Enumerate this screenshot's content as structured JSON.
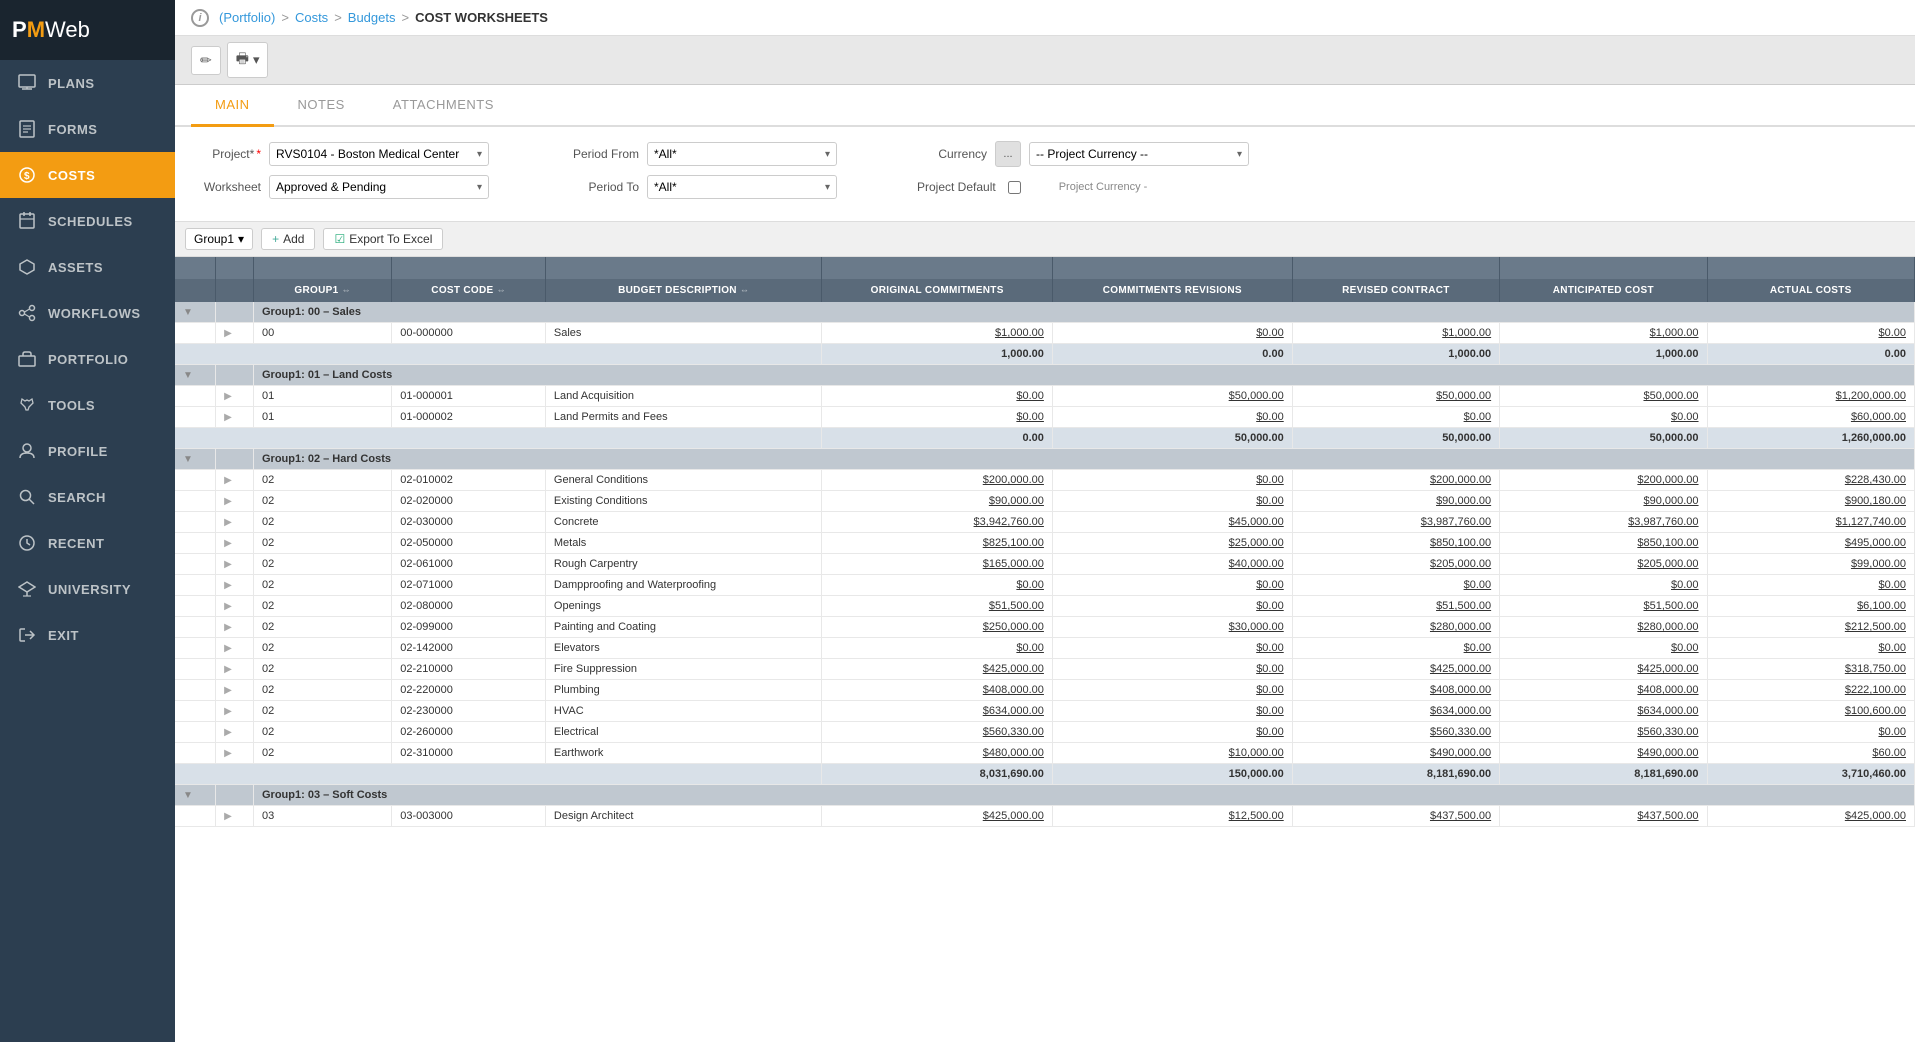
{
  "app": {
    "logo_pm": "PM",
    "logo_web": "Web"
  },
  "breadcrumb": {
    "info_label": "i",
    "portfolio_label": "(Portfolio)",
    "sep1": ">",
    "costs_label": "Costs",
    "sep2": ">",
    "budgets_label": "Budgets",
    "sep3": ">",
    "current_label": "COST WORKSHEETS"
  },
  "toolbar": {
    "edit_icon": "✏",
    "print_icon": "🖶",
    "print_dropdown": "▾"
  },
  "tabs": [
    {
      "id": "main",
      "label": "MAIN",
      "active": true
    },
    {
      "id": "notes",
      "label": "NOTES",
      "active": false
    },
    {
      "id": "attachments",
      "label": "ATTACHMENTS",
      "active": false
    }
  ],
  "form": {
    "project_label": "Project*",
    "project_value": "RVS0104 - Boston Medical Center",
    "worksheet_label": "Worksheet",
    "worksheet_value": "Approved & Pending",
    "period_from_label": "Period From",
    "period_from_value": "*All*",
    "period_to_label": "Period To",
    "period_to_value": "*All*",
    "currency_label": "Currency",
    "currency_btn": "...",
    "currency_value": "-- Project Currency --",
    "project_default_label": "Project Default",
    "project_currency_label": "Project Currency -"
  },
  "table_controls": {
    "group_selector_label": "Group1",
    "group_dropdown": "▾",
    "add_label": "+ Add",
    "export_label": "Export To Excel",
    "export_icon": "☑"
  },
  "table": {
    "col_headers": [
      "GROUP1",
      "COST CODE",
      "BUDGET DESCRIPTION",
      "ORIGINAL COMMITMENTS",
      "COMMITMENTS REVISIONS",
      "REVISED CONTRACT",
      "ANTICIPATED COST",
      "ACTUAL COSTS"
    ],
    "groups": [
      {
        "id": "00",
        "name": "Group1: 00 – Sales",
        "rows": [
          {
            "group": "00",
            "cost_code": "00-000000",
            "desc": "Sales",
            "orig": "$1,000.00",
            "rev": "$0.00",
            "revised": "$1,000.00",
            "anticipated": "$1,000.00",
            "actual": "$0.00"
          }
        ],
        "subtotal": {
          "orig": "1,000.00",
          "rev": "0.00",
          "revised": "1,000.00",
          "anticipated": "1,000.00",
          "actual": "0.00"
        }
      },
      {
        "id": "01",
        "name": "Group1: 01 – Land Costs",
        "rows": [
          {
            "group": "01",
            "cost_code": "01-000001",
            "desc": "Land Acquisition",
            "orig": "$0.00",
            "rev": "$50,000.00",
            "revised": "$50,000.00",
            "anticipated": "$50,000.00",
            "actual": "$1,200,000.00"
          },
          {
            "group": "01",
            "cost_code": "01-000002",
            "desc": "Land Permits and Fees",
            "orig": "$0.00",
            "rev": "$0.00",
            "revised": "$0.00",
            "anticipated": "$0.00",
            "actual": "$60,000.00"
          }
        ],
        "subtotal": {
          "orig": "0.00",
          "rev": "50,000.00",
          "revised": "50,000.00",
          "anticipated": "50,000.00",
          "actual": "1,260,000.00"
        }
      },
      {
        "id": "02",
        "name": "Group1: 02 – Hard Costs",
        "rows": [
          {
            "group": "02",
            "cost_code": "02-010002",
            "desc": "General Conditions",
            "orig": "$200,000.00",
            "rev": "$0.00",
            "revised": "$200,000.00",
            "anticipated": "$200,000.00",
            "actual": "$228,430.00"
          },
          {
            "group": "02",
            "cost_code": "02-020000",
            "desc": "Existing Conditions",
            "orig": "$90,000.00",
            "rev": "$0.00",
            "revised": "$90,000.00",
            "anticipated": "$90,000.00",
            "actual": "$900,180.00"
          },
          {
            "group": "02",
            "cost_code": "02-030000",
            "desc": "Concrete",
            "orig": "$3,942,760.00",
            "rev": "$45,000.00",
            "revised": "$3,987,760.00",
            "anticipated": "$3,987,760.00",
            "actual": "$1,127,740.00"
          },
          {
            "group": "02",
            "cost_code": "02-050000",
            "desc": "Metals",
            "orig": "$825,100.00",
            "rev": "$25,000.00",
            "revised": "$850,100.00",
            "anticipated": "$850,100.00",
            "actual": "$495,000.00"
          },
          {
            "group": "02",
            "cost_code": "02-061000",
            "desc": "Rough Carpentry",
            "orig": "$165,000.00",
            "rev": "$40,000.00",
            "revised": "$205,000.00",
            "anticipated": "$205,000.00",
            "actual": "$99,000.00"
          },
          {
            "group": "02",
            "cost_code": "02-071000",
            "desc": "Dampproofing and Waterproofing",
            "orig": "$0.00",
            "rev": "$0.00",
            "revised": "$0.00",
            "anticipated": "$0.00",
            "actual": "$0.00"
          },
          {
            "group": "02",
            "cost_code": "02-080000",
            "desc": "Openings",
            "orig": "$51,500.00",
            "rev": "$0.00",
            "revised": "$51,500.00",
            "anticipated": "$51,500.00",
            "actual": "$6,100.00"
          },
          {
            "group": "02",
            "cost_code": "02-099000",
            "desc": "Painting and Coating",
            "orig": "$250,000.00",
            "rev": "$30,000.00",
            "revised": "$280,000.00",
            "anticipated": "$280,000.00",
            "actual": "$212,500.00"
          },
          {
            "group": "02",
            "cost_code": "02-142000",
            "desc": "Elevators",
            "orig": "$0.00",
            "rev": "$0.00",
            "revised": "$0.00",
            "anticipated": "$0.00",
            "actual": "$0.00"
          },
          {
            "group": "02",
            "cost_code": "02-210000",
            "desc": "Fire Suppression",
            "orig": "$425,000.00",
            "rev": "$0.00",
            "revised": "$425,000.00",
            "anticipated": "$425,000.00",
            "actual": "$318,750.00"
          },
          {
            "group": "02",
            "cost_code": "02-220000",
            "desc": "Plumbing",
            "orig": "$408,000.00",
            "rev": "$0.00",
            "revised": "$408,000.00",
            "anticipated": "$408,000.00",
            "actual": "$222,100.00"
          },
          {
            "group": "02",
            "cost_code": "02-230000",
            "desc": "HVAC",
            "orig": "$634,000.00",
            "rev": "$0.00",
            "revised": "$634,000.00",
            "anticipated": "$634,000.00",
            "actual": "$100,600.00"
          },
          {
            "group": "02",
            "cost_code": "02-260000",
            "desc": "Electrical",
            "orig": "$560,330.00",
            "rev": "$0.00",
            "revised": "$560,330.00",
            "anticipated": "$560,330.00",
            "actual": "$0.00"
          },
          {
            "group": "02",
            "cost_code": "02-310000",
            "desc": "Earthwork",
            "orig": "$480,000.00",
            "rev": "$10,000.00",
            "revised": "$490,000.00",
            "anticipated": "$490,000.00",
            "actual": "$60.00"
          }
        ],
        "subtotal": {
          "orig": "8,031,690.00",
          "rev": "150,000.00",
          "revised": "8,181,690.00",
          "anticipated": "8,181,690.00",
          "actual": "3,710,460.00"
        }
      },
      {
        "id": "03",
        "name": "Group1: 03 – Soft Costs",
        "rows": [
          {
            "group": "03",
            "cost_code": "03-003000",
            "desc": "Design Architect",
            "orig": "$425,000.00",
            "rev": "$12,500.00",
            "revised": "$437,500.00",
            "anticipated": "$437,500.00",
            "actual": "$425,000.00"
          }
        ],
        "subtotal": null
      }
    ]
  },
  "nav": {
    "plans_label": "PLANS",
    "forms_label": "FORMS",
    "costs_label": "COSTS",
    "schedules_label": "SCHEDULES",
    "assets_label": "ASSETS",
    "workflows_label": "WORKFLOWS",
    "portfolio_label": "PORTFOLIO",
    "tools_label": "TOOLS",
    "profile_label": "PROFILE",
    "search_label": "SEARCH",
    "recent_label": "RECENT",
    "university_label": "UNIVERSITY",
    "exit_label": "EXIT"
  }
}
